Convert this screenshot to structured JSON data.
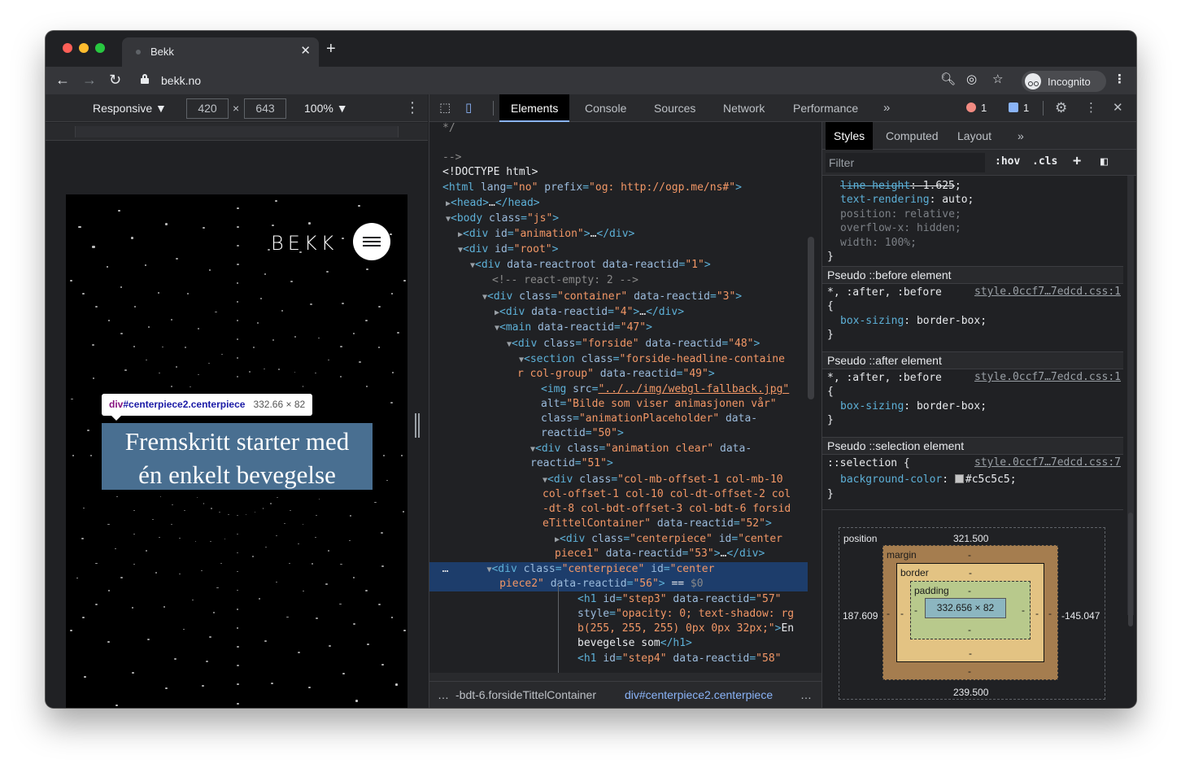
{
  "browser": {
    "tab_title": "Bekk",
    "url": "bekk.no",
    "profile_label": "Incognito"
  },
  "device_toolbar": {
    "mode": "Responsive ▼",
    "width": "420",
    "x_symbol": "×",
    "height": "643",
    "zoom": "100% ▼"
  },
  "page": {
    "logo": "BEKK",
    "headline_line1": "Fremskritt starter med",
    "headline_line2": "én enkelt bevegelse",
    "tooltip_tag": "div",
    "tooltip_selector": "#centerpiece2.centerpiece",
    "tooltip_dims": "332.66 × 82"
  },
  "devtools": {
    "tabs": [
      "Elements",
      "Console",
      "Sources",
      "Network",
      "Performance"
    ],
    "more_tabs": "»",
    "error_count": "1",
    "message_count": "1"
  },
  "breadcrumbs": {
    "ellipsis_left": "…",
    "item1": "-bdt-6.forsideTittelContainer",
    "item2": "div#centerpiece2.centerpiece",
    "ellipsis_right": "…"
  },
  "styles_pane": {
    "tabs": [
      "Styles",
      "Computed",
      "Layout"
    ],
    "more_tabs": "»",
    "filter_placeholder": "Filter",
    "hov": ":hov",
    "cls": ".cls",
    "rule1": [
      {
        "prop": "line-height",
        "val": "1.625",
        "struck": true
      },
      {
        "prop": "text-rendering",
        "val": "auto",
        "struck": false,
        "inherited": false
      },
      {
        "prop": "position",
        "val": "relative",
        "inherited": true
      },
      {
        "prop": "overflow-x",
        "val": "hidden",
        "inherited": true
      },
      {
        "prop": "width",
        "val": "100%",
        "inherited": true
      }
    ],
    "pseudo_before_header": "Pseudo ::before element",
    "pseudo_after_header": "Pseudo ::after element",
    "pseudo_selection_header": "Pseudo ::selection element",
    "universal_selector": "*, :after, :before",
    "source_css1": "style.0ccf7…7edcd.css:1",
    "source_css7": "style.0ccf7…7edcd.css:7",
    "box_sizing_prop": "box-sizing",
    "box_sizing_val": "border-box",
    "selection_selector": "::selection {",
    "bg_prop": "background-color",
    "bg_val": "#c5c5c5"
  },
  "box_model": {
    "position_label": "position",
    "position_top": "321.500",
    "position_left": "187.609",
    "position_right": "-145.047",
    "position_bottom": "239.500",
    "margin_label": "margin",
    "border_label": "border",
    "padding_label": "padding",
    "dash": "-",
    "content_size": "332.656 × 82"
  },
  "colors": {
    "devtools_bg": "#202124",
    "selection_row": "#1d3d6b",
    "highlight_overlay": "#6fa8dc",
    "tag_color": "#5db0d7",
    "attr_value_color": "#f29766"
  }
}
